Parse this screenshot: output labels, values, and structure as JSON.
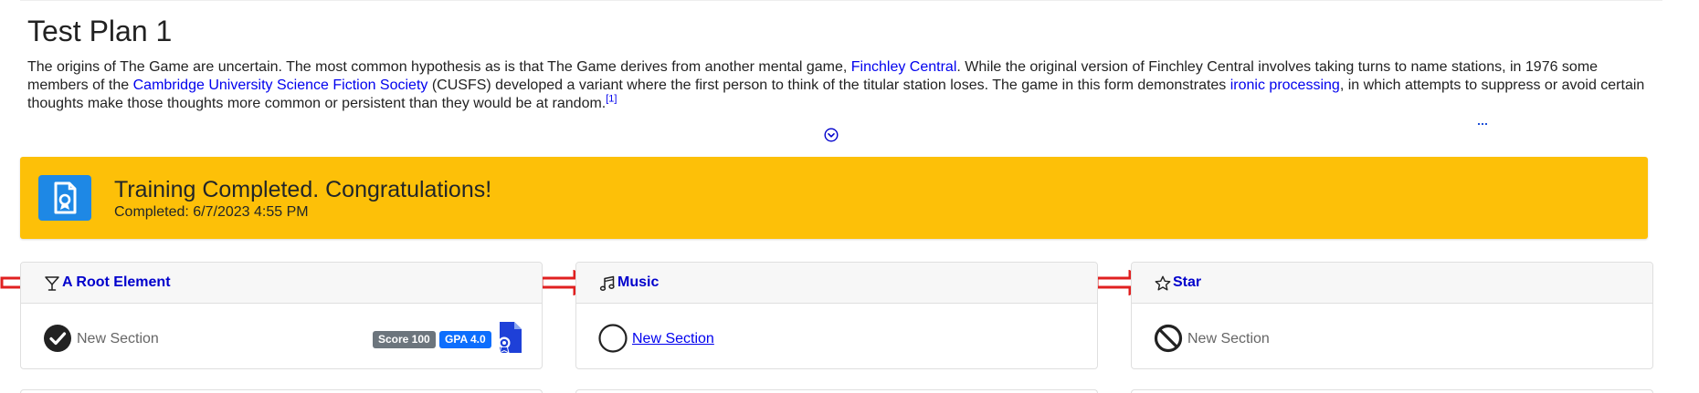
{
  "page": {
    "title": "Test Plan 1",
    "intro": {
      "t1": "The origins of The Game are uncertain. The most common hypothesis as is that The Game derives from another mental game, ",
      "link1": "Finchley Central",
      "t2": ". While the original version of Finchley Central involves taking turns to name stations, in 1976 some members of the ",
      "link2": "Cambridge University Science Fiction Society",
      "t3": " (CUSFS) developed a variant where the first person to think of the titular station loses. The game in this form demonstrates ",
      "link3": "ironic processing",
      "t4": ", in which attempts to suppress or avoid certain thoughts make those thoughts more common or persistent than they would be at random.",
      "ref": "[1]"
    },
    "expand_icon": "chevron-down-circle-icon"
  },
  "banner": {
    "title": "Training Completed. Congratulations!",
    "completed": "Completed: 6/7/2023 4:55 PM",
    "icon": "certificate-icon",
    "color": "#fdc008"
  },
  "cards": [
    {
      "title": "A Root Element",
      "header_icon": "martini-glass-icon",
      "status_icon": "check-circle-icon",
      "section": "New Section",
      "score": "Score 100",
      "gpa": "GPA 4.0",
      "cert_icon": "certificate-icon"
    },
    {
      "title": "Music",
      "header_icon": "music-note-icon",
      "status_icon": "empty-circle-icon",
      "section": "New Section"
    },
    {
      "title": "Star",
      "header_icon": "star-outline-icon",
      "status_icon": "ban-icon",
      "section": "New Section"
    }
  ],
  "annotation_color": "#e02020"
}
